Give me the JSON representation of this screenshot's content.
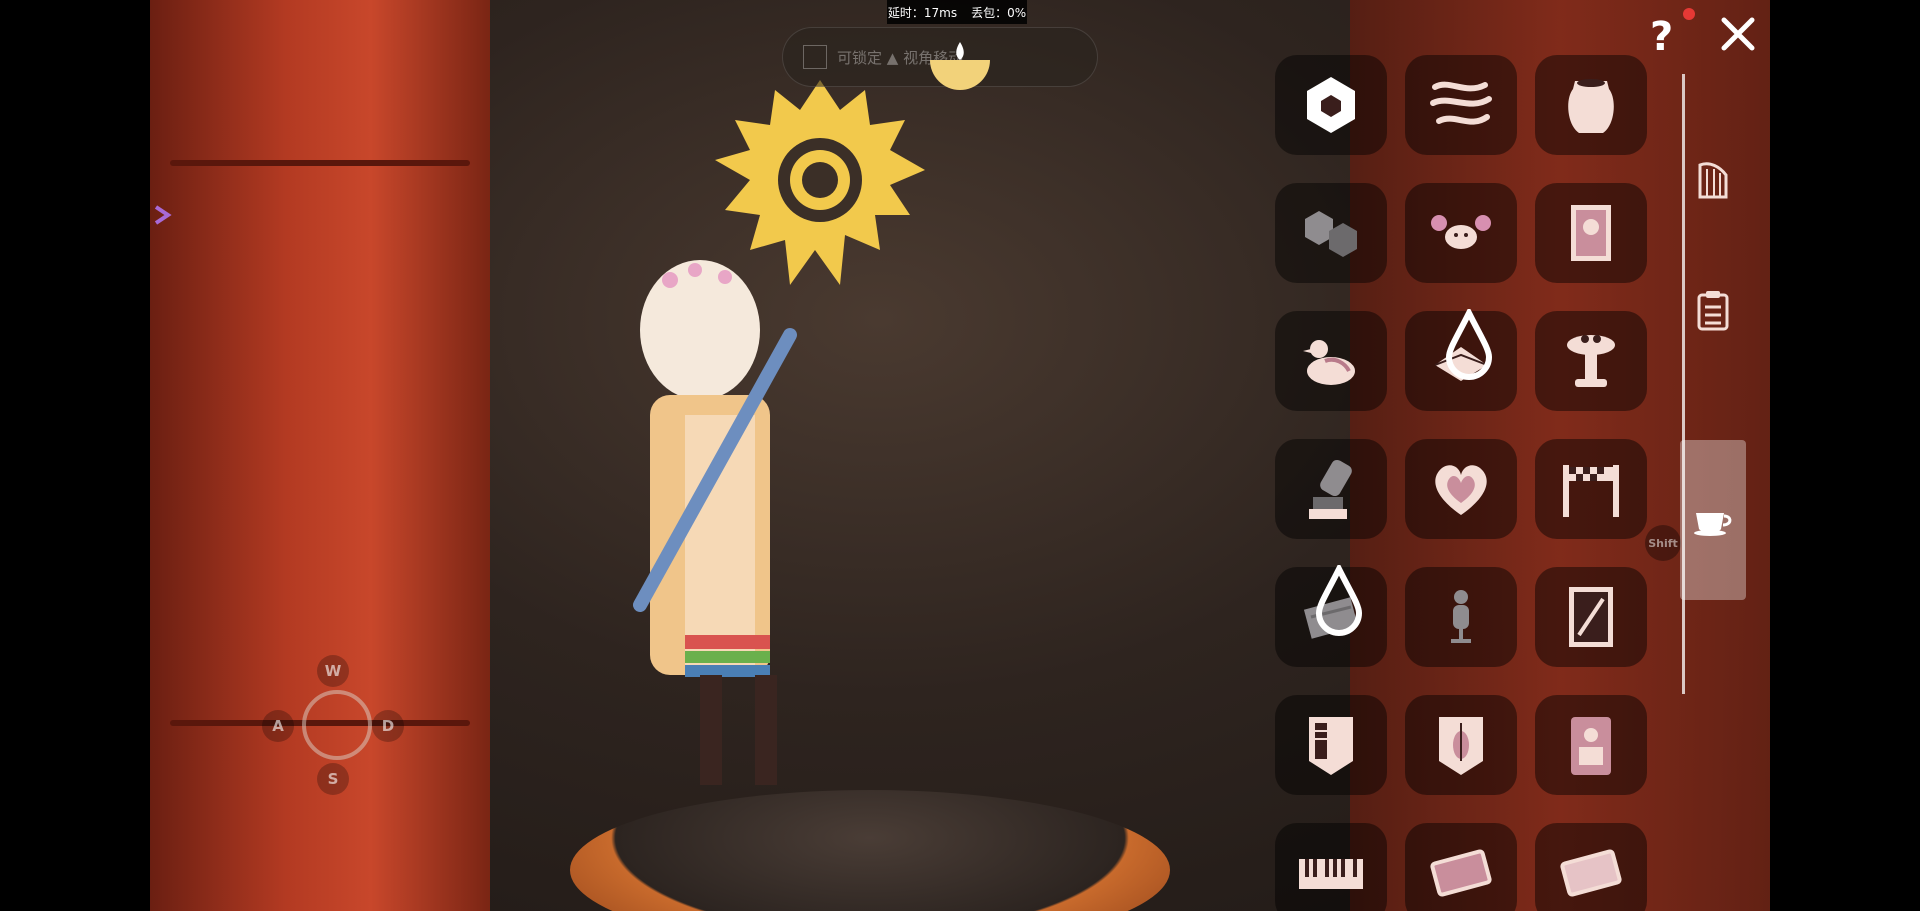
{
  "status_bar": {
    "latency": "延时：17ms",
    "packet_loss": "丢包：0%"
  },
  "hint": {
    "text": "可锁定 ▲ 视角移动"
  },
  "top_controls": {
    "help_label": "?",
    "close_icon": "close-icon"
  },
  "movement_keys": {
    "up": "W",
    "left": "A",
    "right": "D",
    "down": "S"
  },
  "shift_key": "Shift",
  "colors": {
    "icon": "#f4ddd6",
    "icon_dark": "#3a1e1c",
    "panel_slot": "rgba(0,0,0,0.45)",
    "sun": "#f2c94c",
    "pillar": "#c8472b"
  },
  "sidebar": {
    "tabs": [
      {
        "icon": "harp-icon",
        "active": false
      },
      {
        "icon": "clipboard-icon",
        "active": false
      },
      {
        "icon": "teacup-icon",
        "active": true
      }
    ]
  },
  "props": {
    "items": [
      {
        "icon": "hexagon-stone-icon"
      },
      {
        "icon": "wind-waves-icon"
      },
      {
        "icon": "pot-icon"
      },
      {
        "icon": "hexagon-pair-icon"
      },
      {
        "icon": "crab-icon"
      },
      {
        "icon": "portrait-icon"
      },
      {
        "icon": "bird-icon"
      },
      {
        "icon": "cushion-icon",
        "has_drop": true
      },
      {
        "icon": "fountain-icon"
      },
      {
        "icon": "telescope-icon"
      },
      {
        "icon": "heart-icon"
      },
      {
        "icon": "checkered-gate-icon"
      },
      {
        "icon": "mat-icon",
        "has_drop": true
      },
      {
        "icon": "mannequin-icon"
      },
      {
        "icon": "card-icon"
      },
      {
        "icon": "piano-banner-icon"
      },
      {
        "icon": "violin-banner-icon"
      },
      {
        "icon": "poster-icon"
      },
      {
        "icon": "piano-icon"
      },
      {
        "icon": "rug-icon"
      },
      {
        "icon": "tablet-icon"
      }
    ]
  }
}
